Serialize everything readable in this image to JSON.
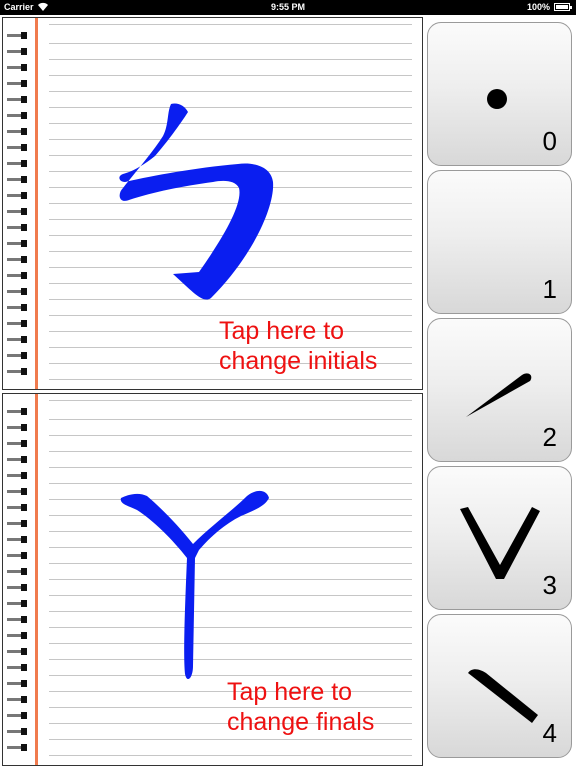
{
  "status_bar": {
    "carrier": "Carrier",
    "time": "9:55 PM",
    "battery": "100%"
  },
  "initials": {
    "character": "ㄅ",
    "hint": "Tap here to\nchange initials"
  },
  "finals": {
    "character": "ㄚ",
    "hint": "Tap here to\nchange finals"
  },
  "tones": [
    {
      "number": "0",
      "mark": "neutral-tone-dot-icon"
    },
    {
      "number": "1",
      "mark": "first-tone-icon"
    },
    {
      "number": "2",
      "mark": "second-tone-rising-stroke-icon"
    },
    {
      "number": "3",
      "mark": "third-tone-v-icon"
    },
    {
      "number": "4",
      "mark": "fourth-tone-falling-stroke-icon"
    }
  ],
  "colors": {
    "stroke": "#0a1ef0",
    "hint_text": "#ee1111",
    "margin_line": "#f07b4e"
  }
}
